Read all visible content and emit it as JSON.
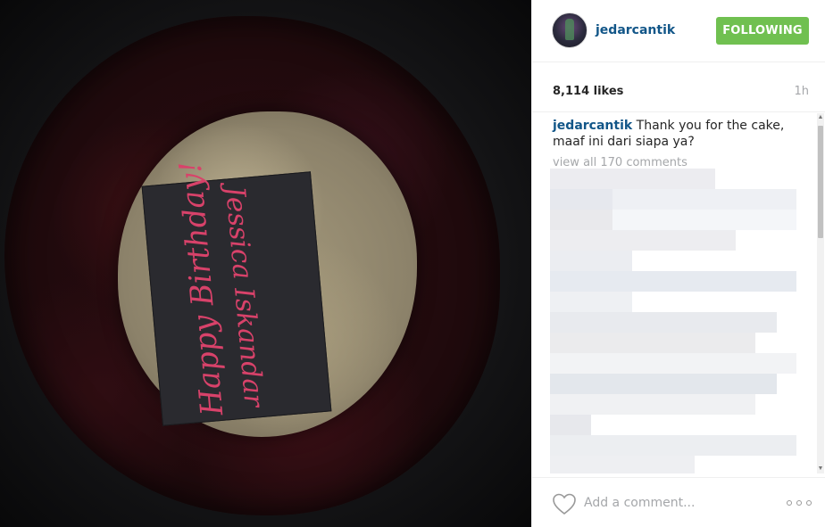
{
  "post": {
    "username": "jedarcantik",
    "follow_label": "FOLLOWING",
    "likes": "8,114 likes",
    "time": "1h"
  },
  "caption": {
    "username": "jedarcantik",
    "text": "Thank you for the cake, maaf ini dari siapa ya?"
  },
  "comments": {
    "view_all": "view all 170 comments"
  },
  "photo": {
    "card_line_1": "Happy Birthday!",
    "card_line_2": "Jessica Iskandar"
  },
  "footer": {
    "comment_placeholder": "Add a comment..."
  },
  "colors": {
    "username": "#125688",
    "follow_button": "#70c050",
    "muted": "#a5a7aa"
  },
  "icons": {
    "like": "heart-icon",
    "more": "more-options-icon",
    "scroll_up": "scroll-up-arrow-icon",
    "scroll_down": "scroll-down-arrow-icon"
  }
}
